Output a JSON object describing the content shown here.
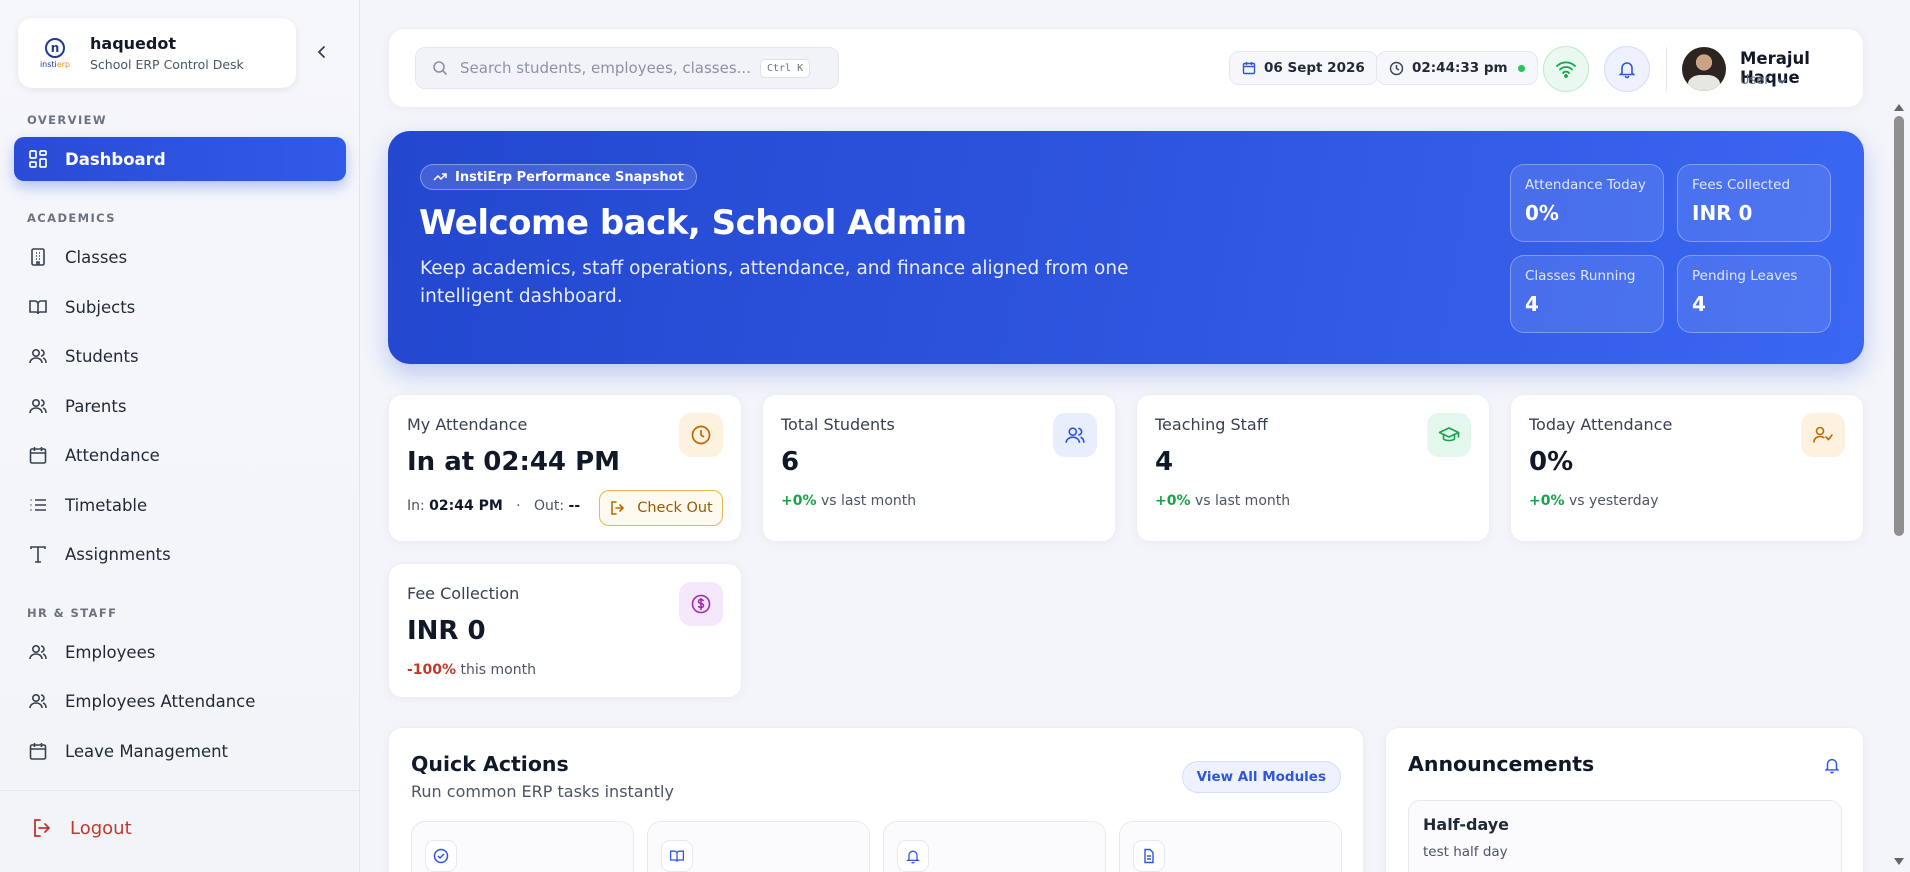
{
  "brand": {
    "name": "haquedot",
    "subtitle": "School ERP Control Desk",
    "logo_text_a": "insti",
    "logo_text_b": "erp",
    "logo_letter": "n"
  },
  "sidebar": {
    "sections": {
      "overview": "OVERVIEW",
      "academics": "ACADEMICS",
      "hr": "HR & STAFF"
    },
    "items": [
      {
        "label": "Dashboard",
        "icon": "dashboard-icon",
        "active": true
      },
      {
        "label": "Classes",
        "icon": "building-icon"
      },
      {
        "label": "Subjects",
        "icon": "book-icon"
      },
      {
        "label": "Students",
        "icon": "users-icon"
      },
      {
        "label": "Parents",
        "icon": "users-icon"
      },
      {
        "label": "Attendance",
        "icon": "calendar-icon"
      },
      {
        "label": "Timetable",
        "icon": "list-icon"
      },
      {
        "label": "Assignments",
        "icon": "type-icon"
      },
      {
        "label": "Employees",
        "icon": "users-icon"
      },
      {
        "label": "Employees Attendance",
        "icon": "users-icon"
      },
      {
        "label": "Leave Management",
        "icon": "calendar-icon"
      }
    ],
    "logout": "Logout"
  },
  "topbar": {
    "search_placeholder": "Search students, employees, classes...",
    "shortcut": "Ctrl K",
    "date": "06 Sept 2026",
    "time": "02:44:33 pm",
    "user_name": "Merajul Haque",
    "user_role": "User"
  },
  "hero": {
    "badge": "InstiErp Performance Snapshot",
    "title": "Welcome back, School Admin",
    "subtitle": "Keep academics, staff operations, attendance, and finance aligned from one intelligent dashboard.",
    "stats": [
      {
        "label": "Attendance Today",
        "value": "0%"
      },
      {
        "label": "Fees Collected",
        "value": "INR 0"
      },
      {
        "label": "Classes Running",
        "value": "4"
      },
      {
        "label": "Pending Leaves",
        "value": "4"
      }
    ]
  },
  "cards": {
    "my_attendance": {
      "title": "My Attendance",
      "value": "In at 02:44 PM",
      "in_label": "In:",
      "in_time": "02:44 PM",
      "sep": "·",
      "out_label": "Out:",
      "out_time": "--",
      "button": "Check Out"
    },
    "total_students": {
      "title": "Total Students",
      "value": "6",
      "delta": "+0%",
      "suffix": "vs last month"
    },
    "teaching_staff": {
      "title": "Teaching Staff",
      "value": "4",
      "delta": "+0%",
      "suffix": "vs last month"
    },
    "today_attendance": {
      "title": "Today Attendance",
      "value": "0%",
      "delta": "+0%",
      "suffix": "vs yesterday"
    },
    "fee_collection": {
      "title": "Fee Collection",
      "value": "INR 0",
      "delta": "-100%",
      "suffix": "this month"
    }
  },
  "quick_actions": {
    "title": "Quick Actions",
    "subtitle": "Run common ERP tasks instantly",
    "view_all": "View All Modules"
  },
  "announcements": {
    "title": "Announcements",
    "items": [
      {
        "title": "Half-daye",
        "desc": "test half day"
      }
    ]
  },
  "colors": {
    "primary": "#2f56e0",
    "success": "#16a34a",
    "danger": "#c0392b",
    "warning": "#e7b94a"
  }
}
